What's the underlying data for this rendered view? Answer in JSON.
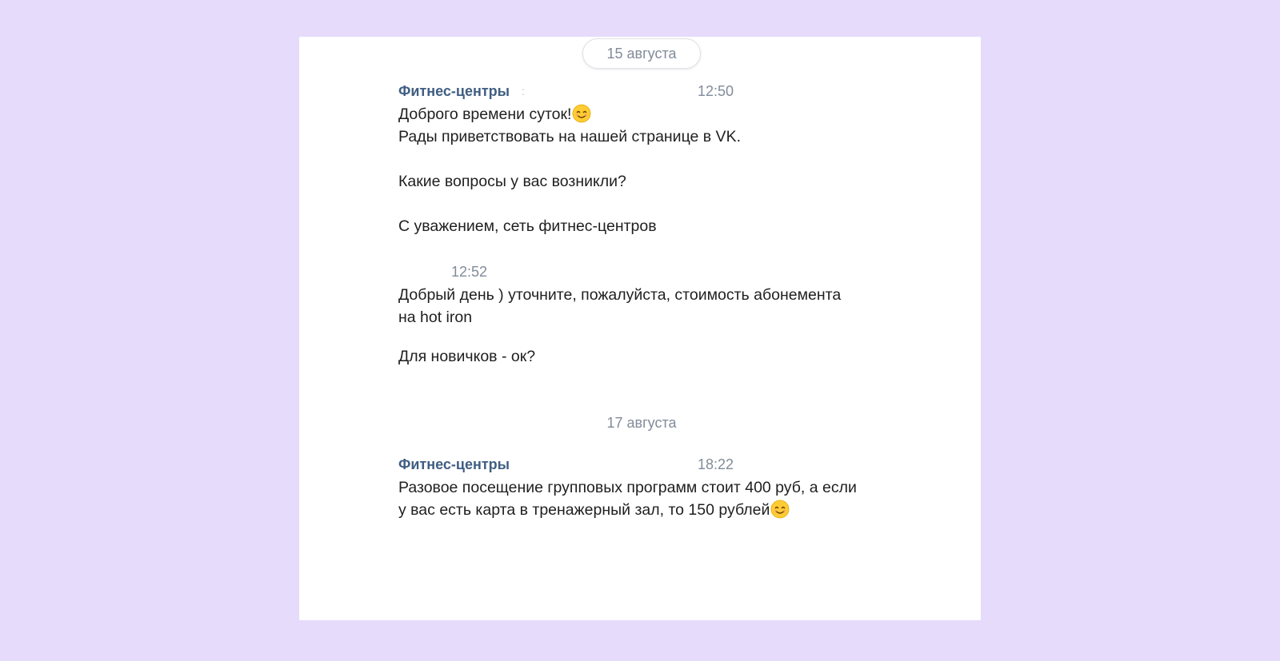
{
  "dates": {
    "first": "15 августа",
    "second": "17 августа"
  },
  "messages": [
    {
      "author": "Фитнес-центры",
      "author_suffix": ":",
      "time": "12:50",
      "lines": [
        "Доброго времени суток!",
        "Рады приветствовать на нашей странице в VK.",
        "Какие вопросы у вас возникли?",
        "С уважением, сеть фитнес-центров"
      ],
      "emoji": "smiling-face-emoji"
    },
    {
      "author": "",
      "time": "12:52",
      "lines": [
        "Добрый день ) уточните, пожалуйста, стоимость абонемента",
        "на hot iron",
        "Для новичков - ок?"
      ]
    },
    {
      "author": "Фитнес-центры",
      "time": "18:22",
      "lines": [
        "Разовое посещение групповых программ стоит 400 руб, а если",
        "у вас есть карта в тренажерный зал, то 150 рублей"
      ],
      "emoji": "smiling-face-emoji"
    }
  ],
  "colors": {
    "page_background": "#e6dbfb",
    "panel_background": "#ffffff",
    "author_color": "#3f5e82",
    "meta_color": "#818c99",
    "text_color": "#1f1f1f"
  }
}
